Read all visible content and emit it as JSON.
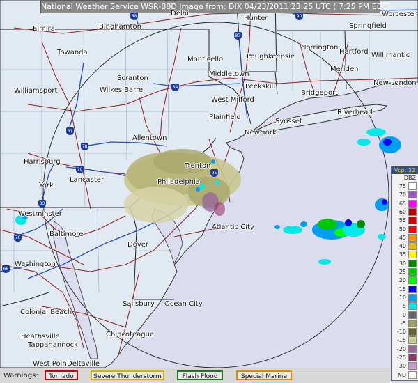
{
  "title": "National Weather Service WSR-88D Image  from: DIX 04/23/2011  23:25 UTC  ( 7:25 PM EDT)",
  "cities": [
    {
      "name": "Elmira"
    },
    {
      "name": "Binghamton"
    },
    {
      "name": "Delhi"
    },
    {
      "name": "Hunter"
    },
    {
      "name": "Worcester"
    },
    {
      "name": "Springfield"
    },
    {
      "name": "Towanda"
    },
    {
      "name": "Monticello"
    },
    {
      "name": "Poughkeepsie"
    },
    {
      "name": "Torrington"
    },
    {
      "name": "Hartford"
    },
    {
      "name": "Willimantic"
    },
    {
      "name": "Middletown"
    },
    {
      "name": "Meriden"
    },
    {
      "name": "New London"
    },
    {
      "name": "Scranton"
    },
    {
      "name": "Wilkes Barre"
    },
    {
      "name": "Williamsport"
    },
    {
      "name": "Peekskill"
    },
    {
      "name": "Bridgeport"
    },
    {
      "name": "West Milford"
    },
    {
      "name": "Riverhead"
    },
    {
      "name": "Syosset"
    },
    {
      "name": "New York"
    },
    {
      "name": "Plainfield"
    },
    {
      "name": "Allentown"
    },
    {
      "name": "Harrisburg"
    },
    {
      "name": "Trenton"
    },
    {
      "name": "Lancaster"
    },
    {
      "name": "Philadelphia"
    },
    {
      "name": "York"
    },
    {
      "name": "Westminster"
    },
    {
      "name": "Atlantic City"
    },
    {
      "name": "Baltimore"
    },
    {
      "name": "Dover"
    },
    {
      "name": "Washington"
    },
    {
      "name": "Salisbury"
    },
    {
      "name": "Ocean City"
    },
    {
      "name": "Colonial Beach"
    },
    {
      "name": "Chincoteague"
    },
    {
      "name": "Heathsville"
    },
    {
      "name": "Tappahannock"
    },
    {
      "name": "West Point"
    },
    {
      "name": "Deltaville"
    }
  ],
  "highways": [
    "88",
    "90",
    "87",
    "84",
    "81",
    "78",
    "76",
    "83",
    "70",
    "95",
    "66"
  ],
  "legend": {
    "vcp": "Vcp: 32",
    "unit": "DBZ",
    "levels": [
      {
        "label": "75",
        "color": "#ffffff"
      },
      {
        "label": "70",
        "color": "#9854c6"
      },
      {
        "label": "65",
        "color": "#f800fd"
      },
      {
        "label": "60",
        "color": "#bc0000"
      },
      {
        "label": "55",
        "color": "#d40000"
      },
      {
        "label": "50",
        "color": "#fd0000"
      },
      {
        "label": "45",
        "color": "#fd9500"
      },
      {
        "label": "40",
        "color": "#e5bc00"
      },
      {
        "label": "35",
        "color": "#fdf802"
      },
      {
        "label": "30",
        "color": "#008e00"
      },
      {
        "label": "25",
        "color": "#01c501"
      },
      {
        "label": "20",
        "color": "#02fd02"
      },
      {
        "label": "15",
        "color": "#0300f4"
      },
      {
        "label": "10",
        "color": "#019ff4"
      },
      {
        "label": "5",
        "color": "#04e9e7"
      },
      {
        "label": "0",
        "color": "#646464"
      },
      {
        "label": "-5",
        "color": "#999966"
      },
      {
        "label": "-10",
        "color": "#666633"
      },
      {
        "label": "-15",
        "color": "#cccc99"
      },
      {
        "label": "-20",
        "color": "#996699"
      },
      {
        "label": "-25",
        "color": "#993366"
      },
      {
        "label": "-30",
        "color": "#cc99cc"
      },
      {
        "label": "ND",
        "color": "#ffffff"
      }
    ]
  },
  "warnings": {
    "title": "Warnings:",
    "items": [
      {
        "label": "Tornado",
        "color": "#cc0000"
      },
      {
        "label": "Severe Thunderstorm",
        "color": "#d4b000"
      },
      {
        "label": "Flash Flood",
        "color": "#1a7a1a"
      },
      {
        "label": "Special Marine",
        "color": "#e08a00"
      }
    ]
  }
}
